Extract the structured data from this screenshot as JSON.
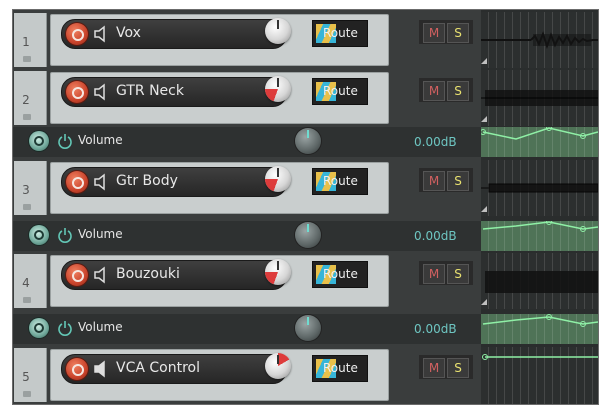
{
  "tracks": [
    {
      "number": "1",
      "name": "Vox",
      "route_label": "Route",
      "mute_label": "M",
      "solo_label": "S",
      "speaker": "speaker-icon"
    },
    {
      "number": "2",
      "name": "GTR Neck",
      "route_label": "Route",
      "mute_label": "M",
      "solo_label": "S",
      "speaker": "speaker-icon"
    },
    {
      "number": "3",
      "name": "Gtr Body",
      "route_label": "Route",
      "mute_label": "M",
      "solo_label": "S",
      "speaker": "speaker-icon"
    },
    {
      "number": "4",
      "name": "Bouzouki",
      "route_label": "Route",
      "mute_label": "M",
      "solo_label": "S",
      "speaker": "speaker-icon"
    },
    {
      "number": "5",
      "name": "VCA Control",
      "route_label": "Route",
      "mute_label": "M",
      "solo_label": "S",
      "speaker": "speaker-filled-icon"
    }
  ],
  "envelopes": [
    {
      "name": "Volume",
      "value": "0.00dB"
    },
    {
      "name": "Volume",
      "value": "0.00dB"
    },
    {
      "name": "Volume",
      "value": "0.00dB"
    }
  ],
  "colors": {
    "record_arm": "#c9432b",
    "mute": "#d06060",
    "solo": "#e8e070",
    "envelope_value": "#6ec6c2",
    "envelope_lane": "#5f8a6a"
  }
}
